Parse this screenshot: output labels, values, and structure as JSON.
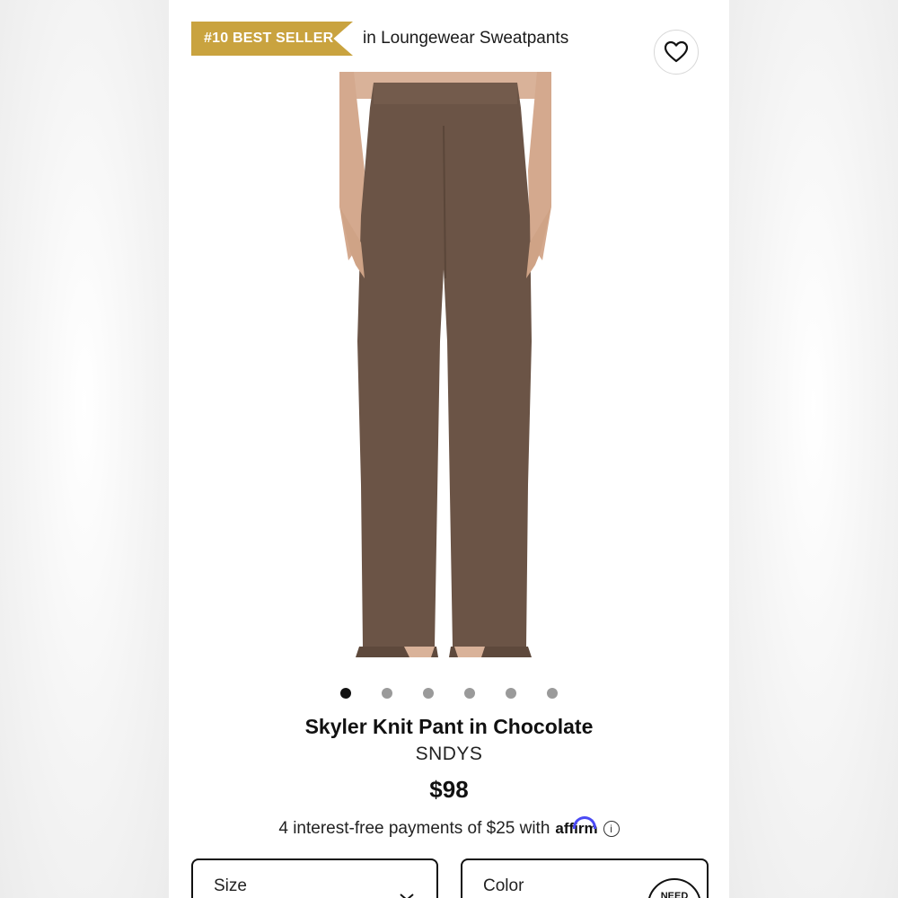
{
  "badge": {
    "rank_label": "#10 BEST SELLER",
    "context": "in Loungewear Sweatpants",
    "color": "#c9a33f"
  },
  "favorite": {
    "icon": "heart-icon"
  },
  "gallery": {
    "total_images": 6,
    "active_index": 0
  },
  "product": {
    "title": "Skyler Knit Pant in Chocolate",
    "brand": "SNDYS",
    "price": "$98",
    "color_swatch": "#6b5446"
  },
  "financing": {
    "text": "4 interest-free payments of $25 with",
    "provider": "affirm",
    "info_icon": "info-icon"
  },
  "selectors": {
    "size_label": "Size",
    "color_label": "Color",
    "need_help_badge": "NEED"
  }
}
